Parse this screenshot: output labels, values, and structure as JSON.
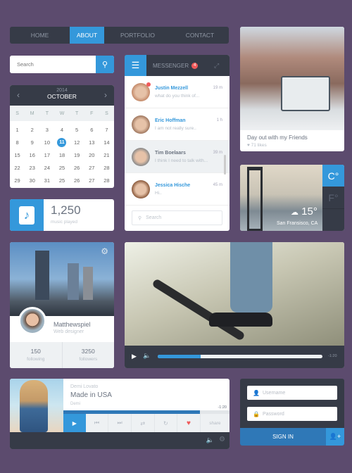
{
  "nav": {
    "items": [
      "HOME",
      "ABOUT",
      "PORTFOLIO",
      "CONTACT"
    ],
    "active": "ABOUT"
  },
  "search": {
    "placeholder": "Search",
    "icon": "search-icon"
  },
  "calendar": {
    "year": "2014",
    "month": "OCTOBER",
    "weekdays": [
      "S",
      "M",
      "T",
      "W",
      "T",
      "F",
      "S"
    ],
    "days": [
      "1",
      "2",
      "3",
      "4",
      "5",
      "6",
      "7",
      "8",
      "9",
      "10",
      "11",
      "12",
      "13",
      "14",
      "15",
      "16",
      "17",
      "18",
      "19",
      "20",
      "21",
      "22",
      "23",
      "24",
      "25",
      "26",
      "27",
      "28",
      "29",
      "30",
      "31",
      "25",
      "26",
      "27",
      "28"
    ],
    "selected": "11"
  },
  "music_stat": {
    "value": "1,250",
    "label": "music played",
    "icon": "music-note-icon"
  },
  "messenger": {
    "title": "MESSENGER",
    "badge": "4",
    "search_placeholder": "Search",
    "messages": [
      {
        "name": "Justin Mezzell",
        "text": "what do you think of...",
        "time": "19 m"
      },
      {
        "name": "Eric Hoffman",
        "text": "I am not really sure..",
        "time": "1 h"
      },
      {
        "name": "Tim Boelaars",
        "text": "I think I need to talk with...",
        "time": "39 m"
      },
      {
        "name": "Jessica Hische",
        "text": "Hi..",
        "time": "45 m"
      }
    ]
  },
  "photo": {
    "caption": "Day out with my Friends",
    "likes": "71 likes"
  },
  "weather": {
    "temp": "15°",
    "city": "San Fransisco, CA",
    "unit_c": "C°",
    "unit_f": "F°"
  },
  "profile": {
    "name": "Matthewspiel",
    "role": "Web designer",
    "following": "150",
    "following_label": "following",
    "followers": "3250",
    "followers_label": "followers"
  },
  "video": {
    "time": "-1:20",
    "progress": 0.26
  },
  "player": {
    "artist": "Demi Lovato",
    "title": "Made in USA",
    "album": "Demi",
    "time": "-1:20",
    "progress": 0.82,
    "share": "share"
  },
  "login": {
    "username_placeholder": "Username",
    "password_placeholder": "Password",
    "signin": "SIGN IN"
  },
  "colors": {
    "accent": "#3498db",
    "dark": "#363b47",
    "background": "#5c4b6e",
    "heart": "#f05a5a"
  }
}
